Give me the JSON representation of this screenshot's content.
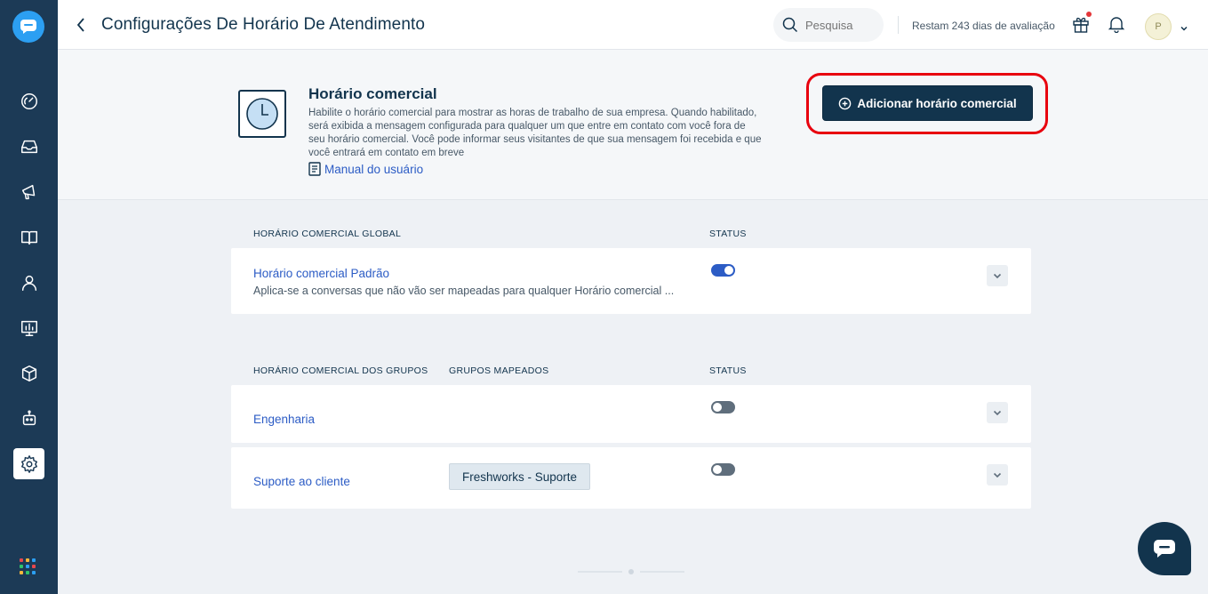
{
  "header": {
    "title": "Configurações De Horário De Atendimento",
    "search_placeholder": "Pesquisa",
    "trial_text": "Restam 243 dias de avaliação",
    "avatar_initial": "P"
  },
  "sidebar": {
    "items": [
      {
        "name": "dashboard",
        "icon": "gauge-icon"
      },
      {
        "name": "inbox",
        "icon": "inbox-icon"
      },
      {
        "name": "campaigns",
        "icon": "megaphone-icon"
      },
      {
        "name": "knowledge-base",
        "icon": "book-icon"
      },
      {
        "name": "contacts",
        "icon": "person-icon"
      },
      {
        "name": "reports",
        "icon": "chart-board-icon"
      },
      {
        "name": "integrations",
        "icon": "cube-icon"
      },
      {
        "name": "bots",
        "icon": "bot-icon"
      },
      {
        "name": "settings",
        "icon": "gear-icon",
        "active": true
      }
    ]
  },
  "intro": {
    "title": "Horário comercial",
    "description": "Habilite o horário comercial para mostrar as horas de trabalho de sua empresa. Quando habilitado, será exibida a mensagem configurada para qualquer um que entre em contato com você fora de seu horário comercial. Você pode informar seus visitantes de que sua mensagem foi recebida e que você entrará em contato em breve",
    "manual_link": "Manual do usuário",
    "add_button": "Adicionar horário comercial"
  },
  "global_section": {
    "col_name": "HORÁRIO COMERCIAL GLOBAL",
    "col_status": "STATUS",
    "rows": [
      {
        "name": "Horário comercial Padrão",
        "subtitle": "Aplica-se a conversas que não vão ser mapeadas para qualquer Horário comercial ...",
        "enabled": true
      }
    ]
  },
  "groups_section": {
    "col_name": "HORÁRIO COMERCIAL DOS GRUPOS",
    "col_groups": "GRUPOS MAPEADOS",
    "col_status": "STATUS",
    "rows": [
      {
        "name": "Engenharia",
        "group": "",
        "enabled": false
      },
      {
        "name": "Suporte ao cliente",
        "group": "Freshworks - Suporte",
        "enabled": false
      }
    ]
  },
  "colors": {
    "sidebar": "#1c3a56",
    "primary_button": "#12344d",
    "link": "#2c5cc5",
    "highlight": "#e8000e"
  }
}
